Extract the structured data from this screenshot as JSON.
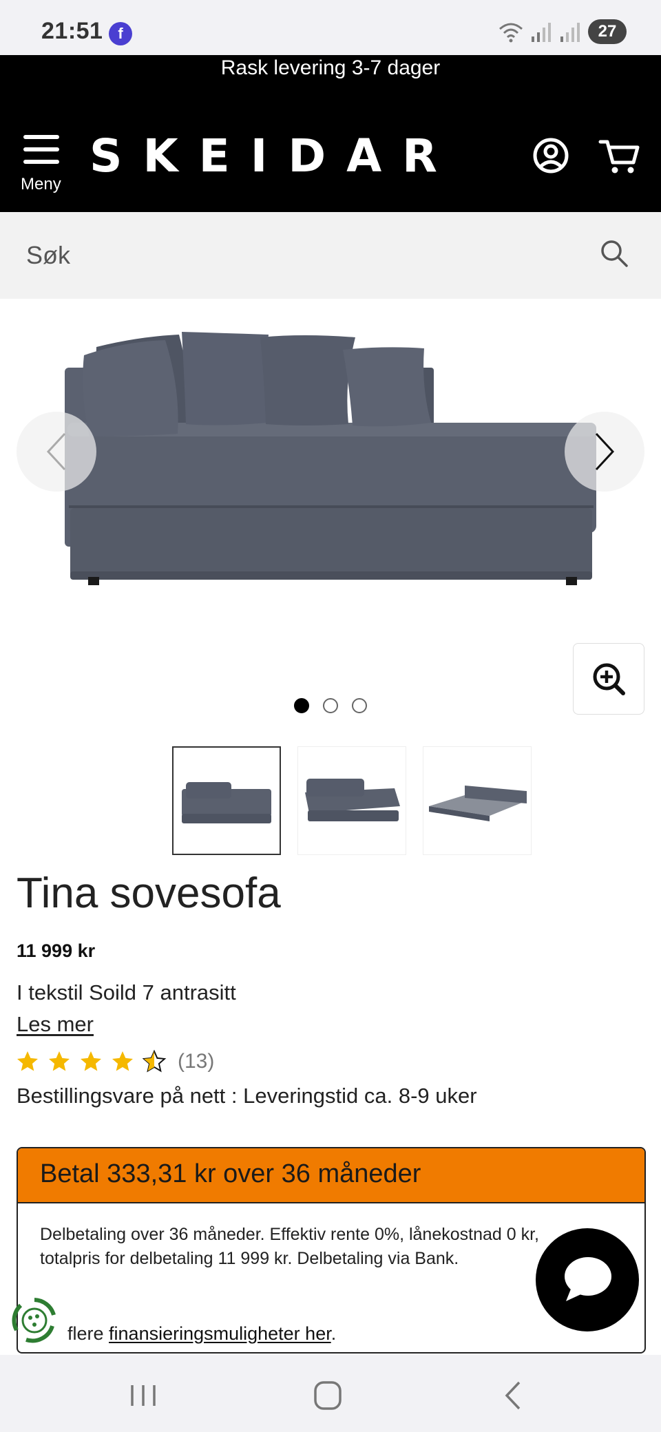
{
  "status_bar": {
    "time": "21:51",
    "app_icon": "f",
    "battery": "27"
  },
  "promo": {
    "text": "Rask levering 3-7 dager"
  },
  "header": {
    "menu_label": "Meny",
    "logo": "SKEIDAR"
  },
  "search": {
    "placeholder": "Søk"
  },
  "gallery": {
    "dots": [
      true,
      false,
      false
    ],
    "thumb_count": 3
  },
  "product": {
    "title": "Tina sovesofa",
    "price": "11 999 kr",
    "variant": "I tekstil Soild 7 antrasitt",
    "read_more": "Les mer",
    "rating_value": 4.5,
    "review_count": "(13)",
    "availability": "Bestillingsvare på nett : Leveringstid ca. 8-9 uker"
  },
  "finance": {
    "header": "Betal 333,31 kr over 36 måneder",
    "body": "Delbetaling over 36 måneder. Effektiv rente 0%, lånekostnad 0 kr, totalpris for delbetaling 11 999 kr. Delbetaling via Bank.",
    "more_prefix": "flere ",
    "more_link": "finansieringsmuligheter her",
    "more_suffix": "."
  },
  "colors": {
    "accent_orange": "#f07b00",
    "star_yellow": "#f5b800",
    "header_bg": "#000000"
  }
}
